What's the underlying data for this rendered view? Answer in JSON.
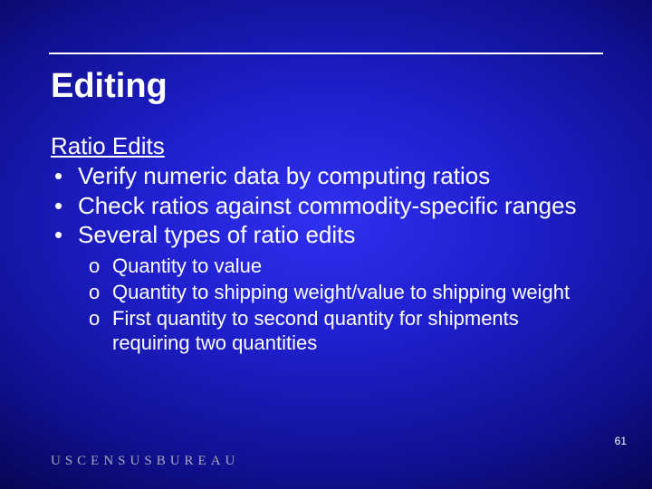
{
  "title": "Editing",
  "subhead": "Ratio Edits",
  "bullets": [
    "Verify numeric data by computing ratios",
    "Check ratios against commodity-specific ranges",
    "Several types of ratio edits"
  ],
  "sub_bullets": [
    "Quantity to value",
    "Quantity to shipping weight/value to shipping weight",
    "First quantity to second quantity for shipments requiring two quantities"
  ],
  "footer_logo": "USCENSUSBUREAU",
  "page_number": "61"
}
